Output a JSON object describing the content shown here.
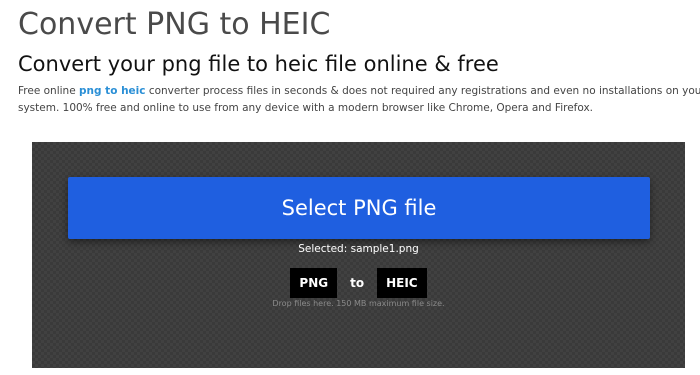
{
  "header": {
    "title": "Convert PNG to HEIC",
    "subtitle": "Convert your png file to heic file online & free"
  },
  "description": {
    "prefix": "Free online ",
    "from_format": "png",
    "connector": " to ",
    "to_format": "heic",
    "suffix": " converter process files in seconds & does not required any registrations and even no installations on your system. 100% free and online to use from any device with a modern browser like Chrome, Opera and Firefox."
  },
  "converter": {
    "select_button_label": "Select PNG file",
    "selected_text": "Selected: sample1.png",
    "from_format": "PNG",
    "to_label": "to",
    "to_format": "HEIC",
    "drop_hint": "Drop files here. 150 MB maximum file size."
  },
  "colors": {
    "accent_button": "#1f5fe0",
    "keyword_link": "#2a8fd6",
    "dropzone_bg": "#3a3a3a"
  }
}
